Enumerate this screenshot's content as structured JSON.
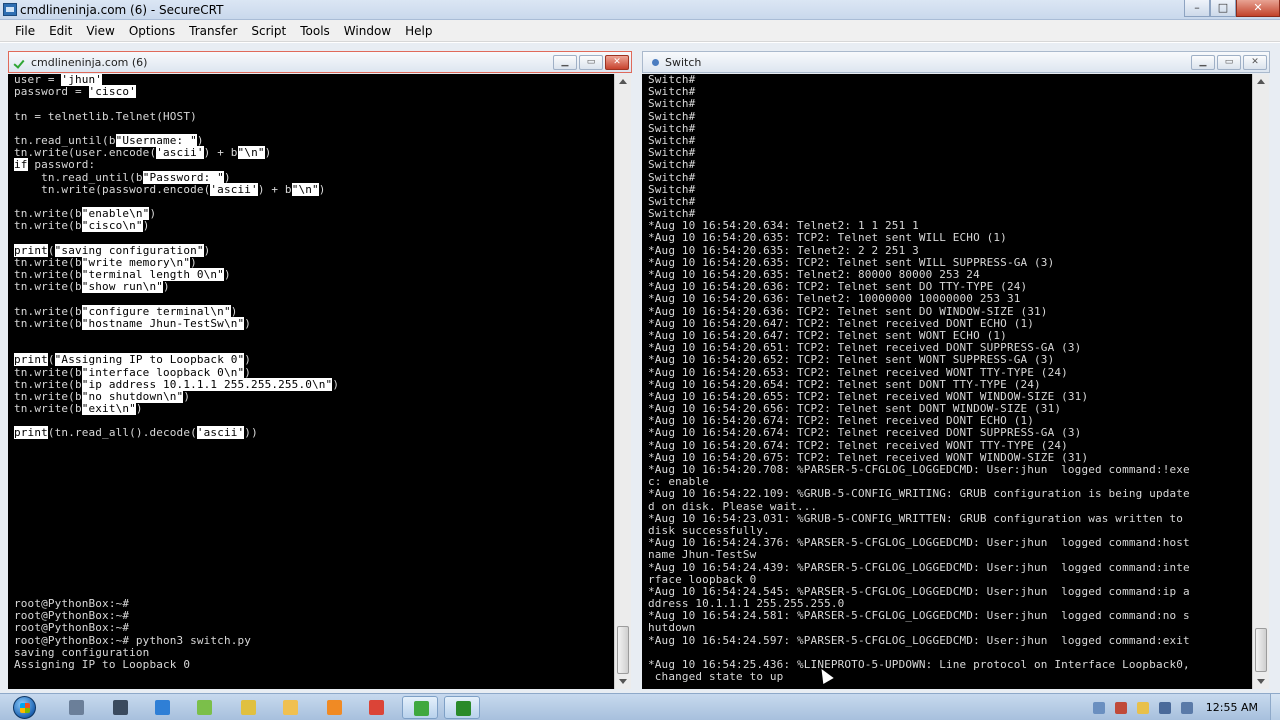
{
  "app": {
    "title": "cmdlineninja.com (6) - SecureCRT"
  },
  "menu": [
    "File",
    "Edit",
    "View",
    "Options",
    "Transfer",
    "Script",
    "Tools",
    "Window",
    "Help"
  ],
  "left_pane": {
    "title": "cmdlineninja.com (6)",
    "lines": [
      [
        {
          "t": "user = "
        },
        {
          "t": "'jhun'",
          "h": 1
        }
      ],
      [
        {
          "t": "password = "
        },
        {
          "t": "'cisco'",
          "h": 1
        }
      ],
      [
        {
          "t": ""
        }
      ],
      [
        {
          "t": "tn = telnetlib.Telnet(HOST)"
        }
      ],
      [
        {
          "t": ""
        }
      ],
      [
        {
          "t": "tn.read_until(b"
        },
        {
          "t": "\"Username: \"",
          "h": 1
        },
        {
          "t": ")"
        }
      ],
      [
        {
          "t": "tn.write(user.encode("
        },
        {
          "t": "'ascii'",
          "h": 1
        },
        {
          "t": ") + b"
        },
        {
          "t": "\"\\n\"",
          "h": 1
        },
        {
          "t": ")"
        }
      ],
      [
        {
          "t": "if",
          "h": 1
        },
        {
          "t": " password:"
        }
      ],
      [
        {
          "t": "    tn.read_until(b"
        },
        {
          "t": "\"Password: \"",
          "h": 1
        },
        {
          "t": ")"
        }
      ],
      [
        {
          "t": "    tn.write(password.encode("
        },
        {
          "t": "'ascii'",
          "h": 1
        },
        {
          "t": ") + b"
        },
        {
          "t": "\"\\n\"",
          "h": 1
        },
        {
          "t": ")"
        }
      ],
      [
        {
          "t": ""
        }
      ],
      [
        {
          "t": "tn.write(b"
        },
        {
          "t": "\"enable\\n\"",
          "h": 1
        },
        {
          "t": ")"
        }
      ],
      [
        {
          "t": "tn.write(b"
        },
        {
          "t": "\"cisco\\n\"",
          "h": 1
        },
        {
          "t": ")"
        }
      ],
      [
        {
          "t": ""
        }
      ],
      [
        {
          "t": "print",
          "h": 1
        },
        {
          "t": "("
        },
        {
          "t": "\"saving configuration\"",
          "h": 1
        },
        {
          "t": ")"
        }
      ],
      [
        {
          "t": "tn.write(b"
        },
        {
          "t": "\"write memory\\n\"",
          "h": 1
        },
        {
          "t": ")"
        }
      ],
      [
        {
          "t": "tn.write(b"
        },
        {
          "t": "\"terminal length 0\\n\"",
          "h": 1
        },
        {
          "t": ")"
        }
      ],
      [
        {
          "t": "tn.write(b"
        },
        {
          "t": "\"show run\\n\"",
          "h": 1
        },
        {
          "t": ")"
        }
      ],
      [
        {
          "t": ""
        }
      ],
      [
        {
          "t": "tn.write(b"
        },
        {
          "t": "\"configure terminal\\n\"",
          "h": 1
        },
        {
          "t": ")"
        }
      ],
      [
        {
          "t": "tn.write(b"
        },
        {
          "t": "\"hostname Jhun-TestSw\\n\"",
          "h": 1
        },
        {
          "t": ")"
        }
      ],
      [
        {
          "t": ""
        }
      ],
      [
        {
          "t": ""
        }
      ],
      [
        {
          "t": "print",
          "h": 1
        },
        {
          "t": "("
        },
        {
          "t": "\"Assigning IP to Loopback 0\"",
          "h": 1
        },
        {
          "t": ")"
        }
      ],
      [
        {
          "t": "tn.write(b"
        },
        {
          "t": "\"interface loopback 0\\n\"",
          "h": 1
        },
        {
          "t": ")"
        }
      ],
      [
        {
          "t": "tn.write(b"
        },
        {
          "t": "\"ip address 10.1.1.1 255.255.255.0\\n\"",
          "h": 1
        },
        {
          "t": ")"
        }
      ],
      [
        {
          "t": "tn.write(b"
        },
        {
          "t": "\"no shutdown\\n\"",
          "h": 1
        },
        {
          "t": ")"
        }
      ],
      [
        {
          "t": "tn.write(b"
        },
        {
          "t": "\"exit\\n\"",
          "h": 1
        },
        {
          "t": ")"
        }
      ],
      [
        {
          "t": ""
        }
      ],
      [
        {
          "t": "print",
          "h": 1
        },
        {
          "t": "(tn.read_all().decode("
        },
        {
          "t": "'ascii'",
          "h": 1
        },
        {
          "t": "))"
        }
      ],
      [
        {
          "t": ""
        }
      ],
      [
        {
          "t": ""
        }
      ],
      [
        {
          "t": ""
        }
      ],
      [
        {
          "t": ""
        }
      ],
      [
        {
          "t": ""
        }
      ],
      [
        {
          "t": ""
        }
      ],
      [
        {
          "t": ""
        }
      ],
      [
        {
          "t": ""
        }
      ],
      [
        {
          "t": ""
        }
      ],
      [
        {
          "t": ""
        }
      ],
      [
        {
          "t": ""
        }
      ],
      [
        {
          "t": ""
        }
      ],
      [
        {
          "t": ""
        }
      ],
      [
        {
          "t": "root@PythonBox:~#"
        }
      ],
      [
        {
          "t": "root@PythonBox:~#"
        }
      ],
      [
        {
          "t": "root@PythonBox:~#"
        }
      ],
      [
        {
          "t": "root@PythonBox:~# python3 switch.py"
        }
      ],
      [
        {
          "t": "saving configuration"
        }
      ],
      [
        {
          "t": "Assigning IP to Loopback 0"
        }
      ]
    ]
  },
  "right_pane": {
    "title": "Switch",
    "lines": [
      [
        {
          "t": "Switch#"
        }
      ],
      [
        {
          "t": "Switch#"
        }
      ],
      [
        {
          "t": "Switch#"
        }
      ],
      [
        {
          "t": "Switch#"
        }
      ],
      [
        {
          "t": "Switch#"
        }
      ],
      [
        {
          "t": "Switch#"
        }
      ],
      [
        {
          "t": "Switch#"
        }
      ],
      [
        {
          "t": "Switch#"
        }
      ],
      [
        {
          "t": "Switch#"
        }
      ],
      [
        {
          "t": "Switch#"
        }
      ],
      [
        {
          "t": "Switch#"
        }
      ],
      [
        {
          "t": "Switch#"
        }
      ],
      [
        {
          "t": "*Aug 10 16:54:20.634: Telnet2: 1 1 251 1"
        }
      ],
      [
        {
          "t": "*Aug 10 16:54:20.635: TCP2: Telnet sent WILL ECHO (1)"
        }
      ],
      [
        {
          "t": "*Aug 10 16:54:20.635: Telnet2: 2 2 251 3"
        }
      ],
      [
        {
          "t": "*Aug 10 16:54:20.635: TCP2: Telnet sent WILL SUPPRESS-GA (3)"
        }
      ],
      [
        {
          "t": "*Aug 10 16:54:20.635: Telnet2: 80000 80000 253 24"
        }
      ],
      [
        {
          "t": "*Aug 10 16:54:20.636: TCP2: Telnet sent DO TTY-TYPE (24)"
        }
      ],
      [
        {
          "t": "*Aug 10 16:54:20.636: Telnet2: 10000000 10000000 253 31"
        }
      ],
      [
        {
          "t": "*Aug 10 16:54:20.636: TCP2: Telnet sent DO WINDOW-SIZE (31)"
        }
      ],
      [
        {
          "t": "*Aug 10 16:54:20.647: TCP2: Telnet received DONT ECHO (1)"
        }
      ],
      [
        {
          "t": "*Aug 10 16:54:20.647: TCP2: Telnet sent WONT ECHO (1)"
        }
      ],
      [
        {
          "t": "*Aug 10 16:54:20.651: TCP2: Telnet received DONT SUPPRESS-GA (3)"
        }
      ],
      [
        {
          "t": "*Aug 10 16:54:20.652: TCP2: Telnet sent WONT SUPPRESS-GA (3)"
        }
      ],
      [
        {
          "t": "*Aug 10 16:54:20.653: TCP2: Telnet received WONT TTY-TYPE (24)"
        }
      ],
      [
        {
          "t": "*Aug 10 16:54:20.654: TCP2: Telnet sent DONT TTY-TYPE (24)"
        }
      ],
      [
        {
          "t": "*Aug 10 16:54:20.655: TCP2: Telnet received WONT WINDOW-SIZE (31)"
        }
      ],
      [
        {
          "t": "*Aug 10 16:54:20.656: TCP2: Telnet sent DONT WINDOW-SIZE (31)"
        }
      ],
      [
        {
          "t": "*Aug 10 16:54:20.674: TCP2: Telnet received DONT ECHO (1)"
        }
      ],
      [
        {
          "t": "*Aug 10 16:54:20.674: TCP2: Telnet received DONT SUPPRESS-GA (3)"
        }
      ],
      [
        {
          "t": "*Aug 10 16:54:20.674: TCP2: Telnet received WONT TTY-TYPE (24)"
        }
      ],
      [
        {
          "t": "*Aug 10 16:54:20.675: TCP2: Telnet received WONT WINDOW-SIZE (31)"
        }
      ],
      [
        {
          "t": "*Aug 10 16:54:20.708: %PARSER-5-CFGLOG_LOGGEDCMD: User:jhun  logged command:!exe"
        }
      ],
      [
        {
          "t": "c: enable"
        }
      ],
      [
        {
          "t": "*Aug 10 16:54:22.109: %GRUB-5-CONFIG_WRITING: GRUB configuration is being update"
        }
      ],
      [
        {
          "t": "d on disk. Please wait..."
        }
      ],
      [
        {
          "t": "*Aug 10 16:54:23.031: %GRUB-5-CONFIG_WRITTEN: GRUB configuration was written to"
        }
      ],
      [
        {
          "t": "disk successfully."
        }
      ],
      [
        {
          "t": "*Aug 10 16:54:24.376: %PARSER-5-CFGLOG_LOGGEDCMD: User:jhun  logged command:host"
        }
      ],
      [
        {
          "t": "name Jhun-TestSw"
        }
      ],
      [
        {
          "t": "*Aug 10 16:54:24.439: %PARSER-5-CFGLOG_LOGGEDCMD: User:jhun  logged command:inte"
        }
      ],
      [
        {
          "t": "rface loopback 0"
        }
      ],
      [
        {
          "t": "*Aug 10 16:54:24.545: %PARSER-5-CFGLOG_LOGGEDCMD: User:jhun  logged command:ip a"
        }
      ],
      [
        {
          "t": "ddress 10.1.1.1 255.255.255.0"
        }
      ],
      [
        {
          "t": "*Aug 10 16:54:24.581: %PARSER-5-CFGLOG_LOGGEDCMD: User:jhun  logged command:no s"
        }
      ],
      [
        {
          "t": "hutdown"
        }
      ],
      [
        {
          "t": "*Aug 10 16:54:24.597: %PARSER-5-CFGLOG_LOGGEDCMD: User:jhun  logged command:exit"
        }
      ],
      [
        {
          "t": ""
        }
      ],
      [
        {
          "t": "*Aug 10 16:54:25.436: %LINEPROTO-5-UPDOWN: Line protocol on Interface Loopback0,"
        }
      ],
      [
        {
          "t": " changed state to up"
        }
      ]
    ]
  },
  "taskbar": {
    "icons": [
      {
        "name": "windows-explorer-icon",
        "color": "#6b7f99"
      },
      {
        "name": "securecrt-icon",
        "color": "#3a4a5e"
      },
      {
        "name": "feather-icon",
        "color": "#2f7fd6"
      },
      {
        "name": "notepad-icon",
        "color": "#7bbf4a"
      },
      {
        "name": "vmware-icon",
        "color": "#e0c040"
      },
      {
        "name": "folder-icon",
        "color": "#f0c050"
      },
      {
        "name": "media-player-icon",
        "color": "#f08a24"
      },
      {
        "name": "chrome-icon",
        "color": "#db4437"
      },
      {
        "name": "camtasia-icon",
        "color": "#3fa83f"
      },
      {
        "name": "terminal-icon",
        "color": "#2a8a2a"
      }
    ],
    "clock": "12:55 AM"
  },
  "colors": {
    "terminal_bg": "#000000",
    "terminal_fg": "#d8d8d8",
    "highlight_bg": "#ffffff"
  }
}
